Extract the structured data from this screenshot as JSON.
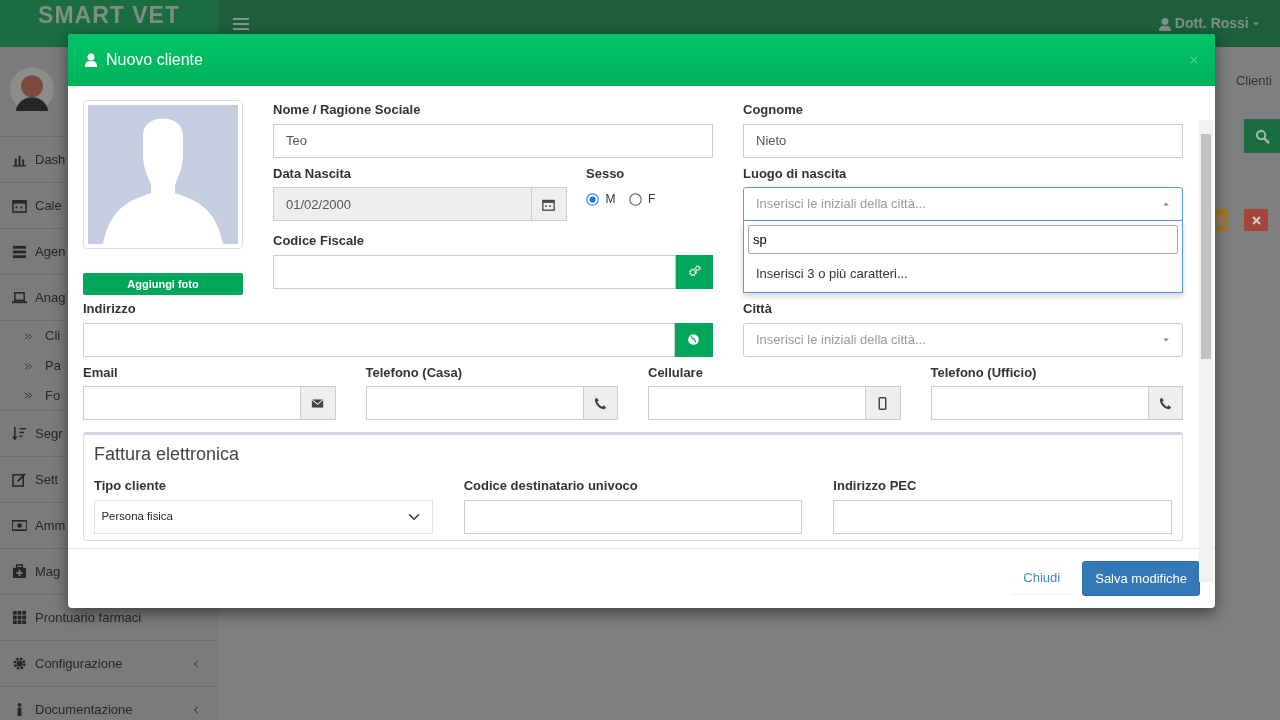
{
  "app": {
    "logo": "SMART VET",
    "user": "Dott. Rossi",
    "breadcrumb": "Clienti",
    "sidebar": [
      {
        "label": "Dash",
        "submenu": false
      },
      {
        "label": "Cale",
        "submenu": false
      },
      {
        "label": "Agen",
        "submenu": false
      },
      {
        "label": "Anag",
        "submenu": false,
        "children": [
          {
            "label": "Cli"
          },
          {
            "label": "Pa"
          },
          {
            "label": "Fo"
          }
        ]
      },
      {
        "label": "Segr",
        "submenu": false
      },
      {
        "label": "Sett",
        "submenu": false
      },
      {
        "label": "Amm",
        "submenu": false
      },
      {
        "label": "Mag",
        "submenu": false
      },
      {
        "label": "Prontuario farmaci",
        "submenu": false
      },
      {
        "label": "Configurazione",
        "submenu": true
      },
      {
        "label": "Documentazione",
        "submenu": true
      }
    ]
  },
  "modal": {
    "title": "Nuovo cliente",
    "photo_button": "Aggiungi foto",
    "nome": {
      "label": "Nome / Ragione Sociale",
      "value": "Teo"
    },
    "cognome": {
      "label": "Cognome",
      "value": "Nieto"
    },
    "data_nascita": {
      "label": "Data Nascita",
      "value": "01/02/2000",
      "disabled": true
    },
    "sesso": {
      "label": "Sesso",
      "options": [
        {
          "label": "M",
          "selected": true
        },
        {
          "label": "F",
          "selected": false
        }
      ]
    },
    "luogo_nascita": {
      "label": "Luogo di nascita",
      "placeholder": "Inserisci le iniziali della città...",
      "expanded": true,
      "search_value": "sp",
      "message": "Inserisci 3 o più caratteri..."
    },
    "codice_fiscale": {
      "label": "Codice Fiscale"
    },
    "indirizzo": {
      "label": "Indirizzo"
    },
    "citta": {
      "label": "Città",
      "placeholder": "Inserisci le iniziali della città..."
    },
    "contacts": [
      {
        "label": "Email"
      },
      {
        "label": "Telefono (Casa)"
      },
      {
        "label": "Cellulare"
      },
      {
        "label": "Telefono (Ufficio)"
      }
    ],
    "fattura": {
      "title": "Fattura elettronica",
      "fields": [
        {
          "label": "Tipo cliente",
          "kind": "select",
          "value": "Persona fisica"
        },
        {
          "label": "Codice destinatario univoco",
          "kind": "text"
        },
        {
          "label": "Indirizzo PEC",
          "kind": "text"
        }
      ]
    },
    "buttons": [
      {
        "label": "Chiudi",
        "kind": "link"
      },
      {
        "label": "Salva modifiche",
        "kind": "primary"
      }
    ]
  }
}
